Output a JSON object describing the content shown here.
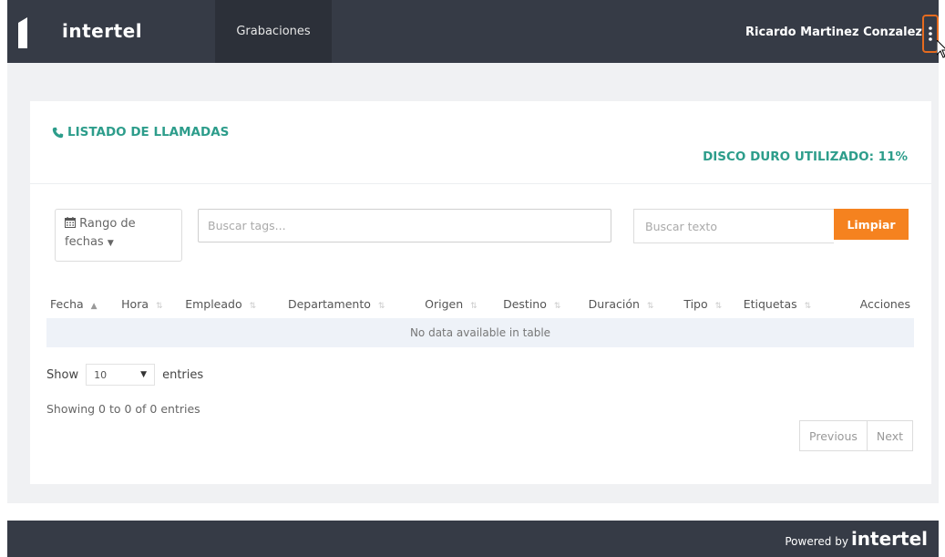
{
  "header": {
    "logo_text": "intertel",
    "nav_tab": "Grabaciones",
    "user_name": "Ricardo Martinez Conzalez"
  },
  "card": {
    "title": "LISTADO DE LLAMADAS",
    "disk_label": "DISCO DURO UTILIZADO: 11%"
  },
  "filters": {
    "date_range_line1": "Rango de",
    "date_range_line2": "fechas",
    "tags_placeholder": "Buscar tags...",
    "text_placeholder": "Buscar texto",
    "clear_label": "Limpiar"
  },
  "table": {
    "columns": [
      "Fecha",
      "Hora",
      "Empleado",
      "Departamento",
      "Origen",
      "Destino",
      "Duración",
      "Tipo",
      "Etiquetas",
      "Acciones"
    ],
    "empty_text": "No data available in table"
  },
  "length_menu": {
    "show_label": "Show",
    "value": "10",
    "entries_label": "entries"
  },
  "info_text": "Showing 0 to 0 of 0 entries",
  "pager": {
    "previous": "Previous",
    "next": "Next"
  },
  "footer": {
    "powered_by": "Powered by",
    "brand": "intertel"
  },
  "colors": {
    "header_bg": "#363b46",
    "accent_teal": "#2d9d8b",
    "accent_orange": "#f5821f"
  }
}
